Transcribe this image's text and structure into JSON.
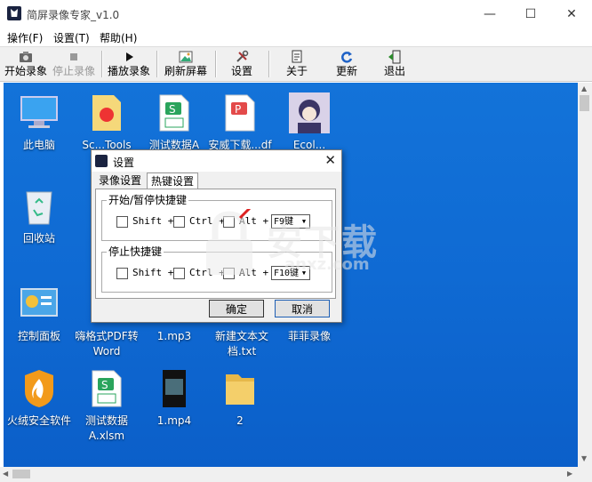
{
  "window": {
    "title": "简屏录像专家_v1.0",
    "minimize": "—",
    "maximize": "☐",
    "close": "✕"
  },
  "menu": {
    "items": [
      "操作(F)",
      "设置(T)",
      "帮助(H)"
    ]
  },
  "toolbar": {
    "start": "开始录象",
    "stop": "停止录像",
    "play": "播放录象",
    "refresh": "刷新屏幕",
    "settings": "设置",
    "about": "关于",
    "update": "更新",
    "exit": "退出"
  },
  "desktop": {
    "icons": [
      {
        "label": "此电脑",
        "icon": "computer-icon"
      },
      {
        "label": "回收站",
        "icon": "recycle-bin-icon"
      },
      {
        "label": "控制面板",
        "icon": "control-panel-icon"
      },
      {
        "label": "火绒安全软件",
        "icon": "huorong-icon"
      },
      {
        "label": "Sc...Tools PD...",
        "icon": "pdf-doc-icon"
      },
      {
        "label": "嗨格式PDF转Word",
        "icon": "pdf-word-app-icon"
      },
      {
        "label": "测试数据A.xlsm",
        "icon": "spreadsheet-icon"
      },
      {
        "label": "测试数据A",
        "icon": "spreadsheet-icon"
      },
      {
        "label": "1.mp3",
        "icon": "audio-file-icon"
      },
      {
        "label": "1.mp4",
        "icon": "video-file-icon"
      },
      {
        "label": "安威下载...df",
        "icon": "pdf-file-icon"
      },
      {
        "label": "新建文本文档.txt",
        "icon": "text-file-icon"
      },
      {
        "label": "2",
        "icon": "folder-icon"
      },
      {
        "label": "Ecol...",
        "icon": "avatar-image-icon"
      },
      {
        "label": "菲菲录像",
        "icon": "recorder-app-icon"
      }
    ]
  },
  "dialog": {
    "title": "设置",
    "close": "✕",
    "tabs": [
      "录像设置",
      "热键设置"
    ],
    "active_tab": "热键设置",
    "groups": [
      {
        "title": "开始/暂停快捷键",
        "shift": "Shift +",
        "ctrl": "Ctrl +",
        "alt": "Alt +",
        "key": "F9键"
      },
      {
        "title": "停止快捷键",
        "shift": "Shift +",
        "ctrl": "Ctrl +",
        "alt": "Alt +",
        "key": "F10键"
      }
    ],
    "ok": "确定",
    "cancel": "取消"
  },
  "watermark": {
    "text": "安下载",
    "url": "anxz.com"
  }
}
